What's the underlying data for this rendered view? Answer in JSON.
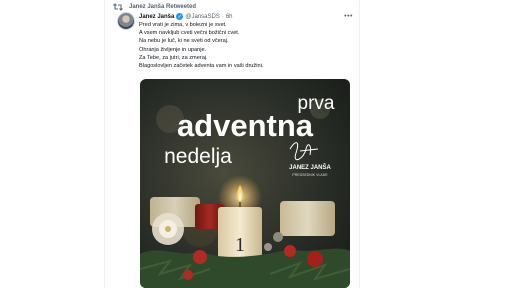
{
  "retweet": {
    "label": "Janez Janša Retweeted",
    "icon": "retweet-icon"
  },
  "tweet": {
    "author_name": "Janez Janša",
    "handle": "@JansaSDS",
    "separator": "·",
    "time": "6h",
    "more_icon": "more-icon",
    "lines": [
      "Pred vrati je zima, v bolezni je svet.",
      "A vsem navkljub cveti večni božični cvet.",
      "Na nebu je luč, ki ne sveti od včeraj.",
      "Ohranja življenje in upanje.",
      "Za Tebe, za jutri, za zmeraj.",
      "Blagoslovljen začetek adventa vam in vaši družini."
    ]
  },
  "media": {
    "title_top": "prva",
    "title_main": "adventna",
    "title_bottom": "nedelja",
    "signature_name": "JANEZ JANŠA",
    "signature_role": "PREDSEDNIK VLADE",
    "candle_number": "1",
    "colors": {
      "candle": "#efe3c2",
      "flame": "#ffd36a",
      "ornament": "#b22a23",
      "greenery": "#2f4a2a"
    }
  }
}
